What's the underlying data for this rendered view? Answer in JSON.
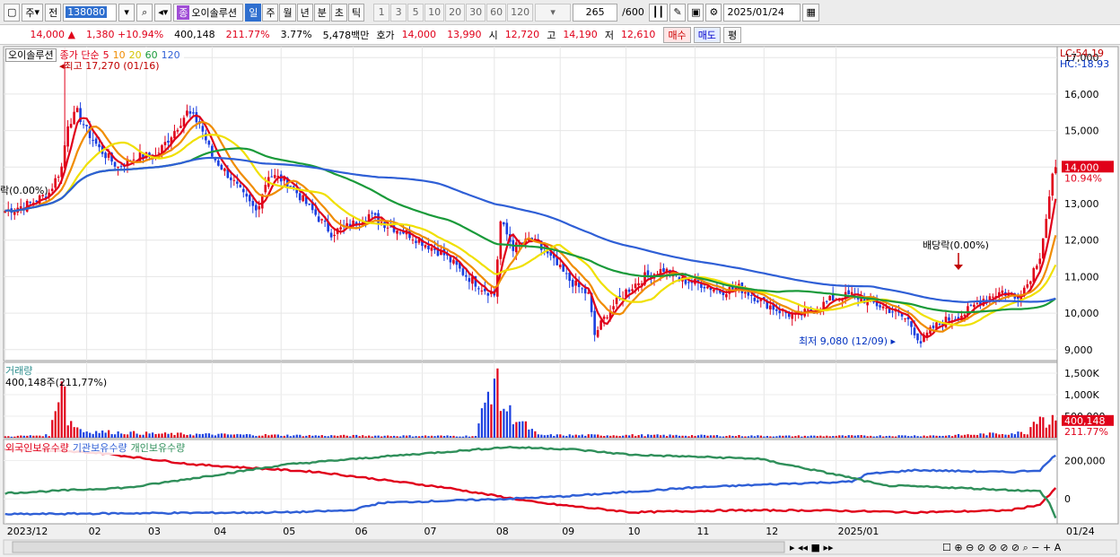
{
  "toolbar": {
    "market_label": "주",
    "prev_label": "전",
    "code": "138080",
    "stock_badge": "종",
    "stock_name": "오이솔루션",
    "periods": [
      "일",
      "주",
      "월",
      "년",
      "분",
      "초",
      "틱"
    ],
    "selected_period": "일",
    "intervals": [
      "1",
      "3",
      "5",
      "10",
      "20",
      "30",
      "60",
      "120"
    ],
    "count": "265",
    "count_total": "/600",
    "date": "2025/01/24"
  },
  "quote": {
    "price": "14,000",
    "change_arrow": "▲",
    "change": "1,380",
    "change_pct": "+10.94%",
    "volume": "400,148",
    "volume_pct": "211.77%",
    "turnover_pct": "3.77%",
    "amount": "5,478백만",
    "hoga_label": "호가",
    "ask": "14,000",
    "bid": "13,990",
    "open_label": "시",
    "open": "12,720",
    "high_label": "고",
    "high": "14,190",
    "low_label": "저",
    "low": "12,610",
    "buy_label": "매수",
    "sell_label": "매도",
    "avg_label": "평"
  },
  "colors": {
    "up": "#e0001a",
    "down": "#1a3fe0",
    "ma5": "#e0001a",
    "ma10": "#f08c00",
    "ma20": "#f0e000",
    "ma60": "#1a9a3a",
    "ma120": "#2f5fd6",
    "foreign": "#e0001a",
    "institution": "#2f5fd6",
    "individual": "#2f8f5a"
  },
  "chart_data": [
    {
      "type": "candlestick",
      "legend_name": "오이솔루션",
      "legend_prefix": "종가 단순",
      "ma_periods": [
        "5",
        "10",
        "20",
        "60",
        "120"
      ],
      "ylim": [
        8700,
        17300
      ],
      "y_ticks": [
        "9,000",
        "10,000",
        "11,000",
        "12,000",
        "13,000",
        "14,000",
        "15,000",
        "16,000",
        "17,000"
      ],
      "y_tick_values": [
        9000,
        10000,
        11000,
        12000,
        13000,
        14000,
        15000,
        16000,
        17000
      ],
      "x_labels": [
        "2023/12",
        "02",
        "03",
        "04",
        "05",
        "06",
        "07",
        "08",
        "09",
        "10",
        "11",
        "12",
        "2025/01",
        "01/24"
      ],
      "lc_label": "LC:54.19",
      "hc_label": "HC:-18.93",
      "last_price_label": "14,000",
      "last_pct_label": "10.94%",
      "high_annotation": "최고 17,270 (01/16)",
      "low_annotation": "최저 9,080 (12/09)",
      "dividend_annotation_left": "락(0.00%)",
      "dividend_annotation_right": "배당락(0.00%)",
      "close_keypoints": [
        [
          0,
          12800
        ],
        [
          8,
          13000
        ],
        [
          14,
          13300
        ],
        [
          18,
          14000
        ],
        [
          20,
          15200
        ],
        [
          23,
          15500
        ],
        [
          26,
          15000
        ],
        [
          30,
          14500
        ],
        [
          36,
          14000
        ],
        [
          42,
          14300
        ],
        [
          48,
          14300
        ],
        [
          54,
          15000
        ],
        [
          58,
          15500
        ],
        [
          62,
          15200
        ],
        [
          66,
          14300
        ],
        [
          72,
          13700
        ],
        [
          76,
          13200
        ],
        [
          80,
          12800
        ],
        [
          84,
          13800
        ],
        [
          90,
          13600
        ],
        [
          96,
          13000
        ],
        [
          100,
          12600
        ],
        [
          104,
          12200
        ],
        [
          110,
          12400
        ],
        [
          116,
          12700
        ],
        [
          122,
          12400
        ],
        [
          128,
          12200
        ],
        [
          134,
          11900
        ],
        [
          140,
          11600
        ],
        [
          146,
          11100
        ],
        [
          152,
          10700
        ],
        [
          156,
          10500
        ],
        [
          158,
          12500
        ],
        [
          162,
          11800
        ],
        [
          168,
          12000
        ],
        [
          174,
          11500
        ],
        [
          180,
          10900
        ],
        [
          186,
          10500
        ],
        [
          188,
          9400
        ],
        [
          192,
          10000
        ],
        [
          198,
          10600
        ],
        [
          204,
          11000
        ],
        [
          210,
          11200
        ],
        [
          216,
          10900
        ],
        [
          222,
          10800
        ],
        [
          228,
          10600
        ],
        [
          234,
          10700
        ],
        [
          240,
          10400
        ],
        [
          246,
          10100
        ],
        [
          252,
          9900
        ],
        [
          258,
          10100
        ],
        [
          264,
          10400
        ],
        [
          270,
          10500
        ],
        [
          276,
          10300
        ],
        [
          282,
          10100
        ],
        [
          288,
          9800
        ],
        [
          292,
          9200
        ],
        [
          296,
          9600
        ],
        [
          300,
          9800
        ],
        [
          306,
          10000
        ],
        [
          312,
          10400
        ],
        [
          318,
          10600
        ],
        [
          322,
          10400
        ],
        [
          326,
          10800
        ],
        [
          330,
          11600
        ],
        [
          332,
          12600
        ],
        [
          334,
          13700
        ],
        [
          335,
          14000
        ]
      ],
      "volume_keypoints": [
        [
          0,
          30
        ],
        [
          14,
          60
        ],
        [
          16,
          600
        ],
        [
          18,
          1700
        ],
        [
          19,
          1200
        ],
        [
          20,
          400
        ],
        [
          25,
          150
        ],
        [
          50,
          90
        ],
        [
          100,
          50
        ],
        [
          150,
          40
        ],
        [
          156,
          1500
        ],
        [
          158,
          800
        ],
        [
          162,
          500
        ],
        [
          170,
          60
        ],
        [
          200,
          60
        ],
        [
          250,
          40
        ],
        [
          300,
          50
        ],
        [
          326,
          120
        ],
        [
          330,
          650
        ],
        [
          332,
          300
        ],
        [
          334,
          450
        ],
        [
          335,
          400
        ]
      ],
      "volume_y_ticks": [
        "500,000",
        "1,000K",
        "1,500K"
      ],
      "volume_y_tick_values": [
        500,
        1000,
        1500
      ],
      "volume_ylim": [
        0,
        1750
      ]
    },
    {
      "type": "bar",
      "legend_name": "거래량",
      "value_label": "400,148주(211,77%)",
      "last_value_label": "400,148",
      "last_pct_label": "211.77%"
    },
    {
      "type": "line",
      "series": [
        {
          "name": "외국인보유수량",
          "color_key": "foreign",
          "points": [
            [
              0,
              260000
            ],
            [
              30,
              240000
            ],
            [
              60,
              180000
            ],
            [
              100,
              140000
            ],
            [
              140,
              60000
            ],
            [
              170,
              -20000
            ],
            [
              200,
              -70000
            ],
            [
              230,
              -60000
            ],
            [
              260,
              -60000
            ],
            [
              290,
              -70000
            ],
            [
              320,
              -60000
            ],
            [
              330,
              -30000
            ],
            [
              333,
              20000
            ],
            [
              335,
              55000
            ]
          ]
        },
        {
          "name": "기관보유수량",
          "color_key": "institution",
          "points": [
            [
              0,
              -80000
            ],
            [
              40,
              -75000
            ],
            [
              90,
              -70000
            ],
            [
              110,
              -60000
            ],
            [
              120,
              -20000
            ],
            [
              160,
              0
            ],
            [
              180,
              15000
            ],
            [
              220,
              60000
            ],
            [
              250,
              80000
            ],
            [
              270,
              90000
            ],
            [
              275,
              130000
            ],
            [
              290,
              150000
            ],
            [
              320,
              140000
            ],
            [
              330,
              150000
            ],
            [
              335,
              230000
            ]
          ]
        },
        {
          "name": "개인보유수량",
          "color_key": "individual",
          "points": [
            [
              0,
              30000
            ],
            [
              40,
              60000
            ],
            [
              90,
              180000
            ],
            [
              120,
              220000
            ],
            [
              160,
              270000
            ],
            [
              180,
              260000
            ],
            [
              200,
              230000
            ],
            [
              240,
              210000
            ],
            [
              270,
              110000
            ],
            [
              280,
              70000
            ],
            [
              300,
              60000
            ],
            [
              330,
              40000
            ],
            [
              333,
              -20000
            ],
            [
              335,
              -100000
            ]
          ]
        }
      ],
      "y_ticks": [
        "200,000",
        "0"
      ],
      "y_tick_values": [
        200000,
        0
      ],
      "ylim": [
        -130000,
        310000
      ]
    }
  ]
}
